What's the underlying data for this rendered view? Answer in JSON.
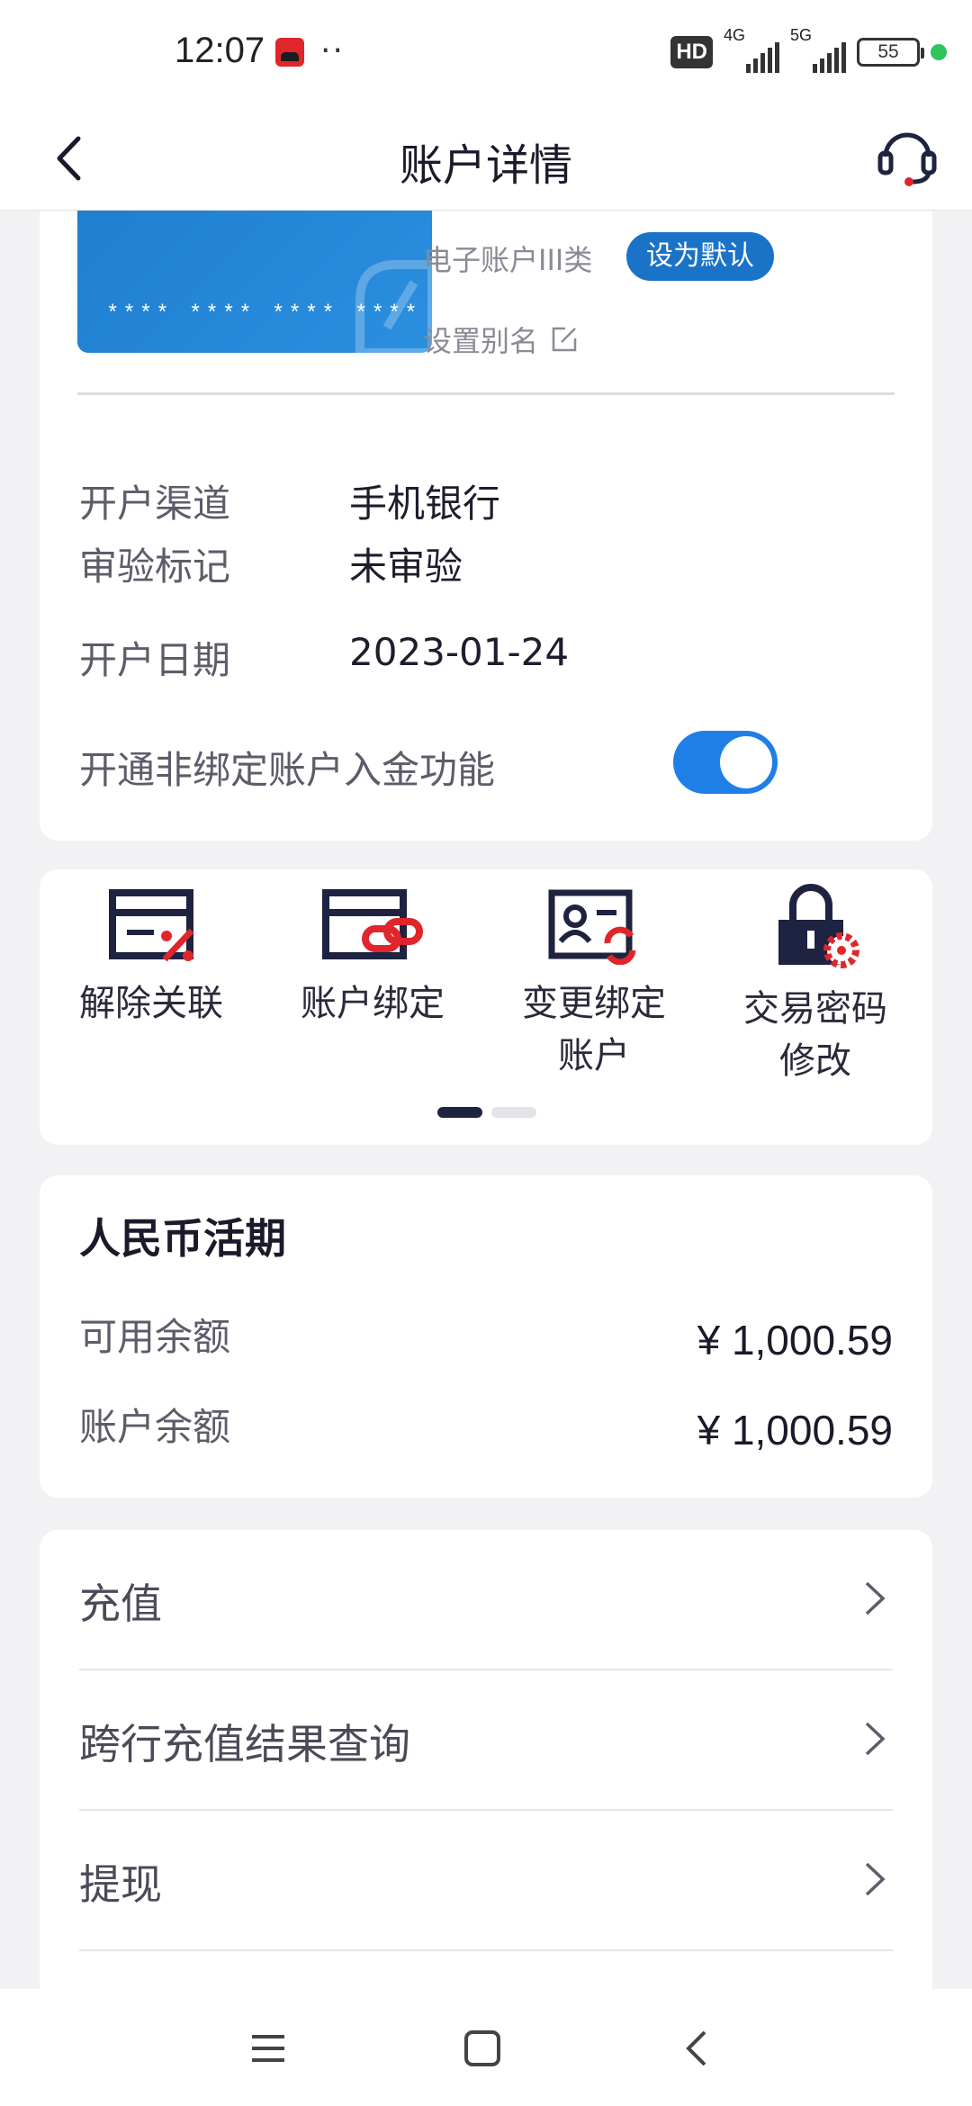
{
  "status_bar": {
    "time": "12:07",
    "more_dots": "··",
    "hd_label": "HD",
    "network_1": "4G",
    "network_2": "5G",
    "battery": "55",
    "app_icon": "tmall-app-icon"
  },
  "header": {
    "title": "账户详情",
    "back_icon": "back-arrow-icon",
    "service_icon": "customer-service-headset-icon"
  },
  "card": {
    "masked_number": "**** **** **** ****",
    "account_type": "电子账户III类",
    "set_default_label": "设为默认",
    "alias_label": "设置别名",
    "brand_color": "#1f7fd0"
  },
  "details": [
    {
      "label": "开户渠道",
      "value": "手机银行"
    },
    {
      "label": "审验标记",
      "value": "未审验"
    },
    {
      "label": "开户日期",
      "value": "2023-01-24"
    }
  ],
  "toggle": {
    "label": "开通非绑定账户入金功能",
    "state": "on",
    "color": "#1f7fe6"
  },
  "functions": [
    {
      "label": "解除关联",
      "icon": "unlink-card-icon"
    },
    {
      "label": "账户绑定",
      "icon": "bind-card-link-icon"
    },
    {
      "label": "变更绑定账户",
      "icon": "change-binding-icon"
    },
    {
      "label": "交易密码修改",
      "icon": "password-lock-gear-icon"
    }
  ],
  "functions_text": {
    "f3_line1": "变更绑定",
    "f3_line2": "账户",
    "f4_line1": "交易密码",
    "f4_line2": "修改"
  },
  "pager": {
    "pages": 2,
    "current": 1
  },
  "balance": {
    "title": "人民币活期",
    "available_label": "可用余额",
    "available_value": "¥ 1,000.59",
    "account_label": "账户余额",
    "account_value": "¥ 1,000.59"
  },
  "menu": [
    {
      "label": "充值"
    },
    {
      "label": "跨行充值结果查询"
    },
    {
      "label": "提现"
    }
  ],
  "accent_red": "#e0262b",
  "dark_navy": "#1d2340"
}
